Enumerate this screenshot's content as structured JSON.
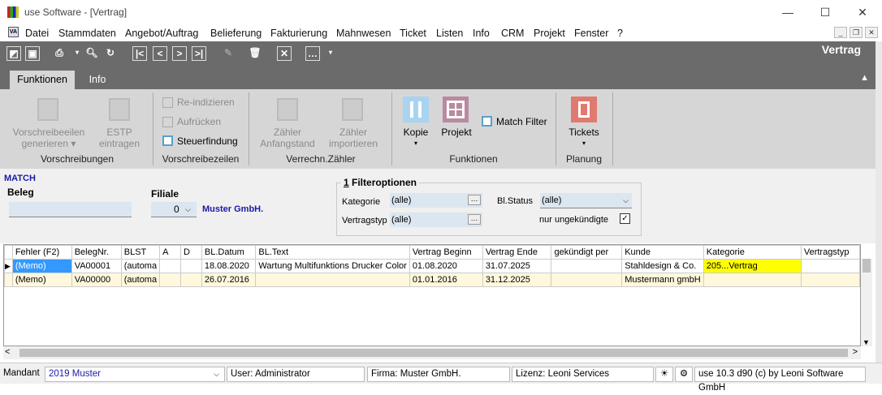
{
  "window": {
    "title": "use Software - [Vertrag]",
    "minimize": "—",
    "maximize": "☐",
    "close": "✕"
  },
  "menu": {
    "items": [
      "Datei",
      "Stammdaten",
      "Angebot/Auftrag",
      "Belieferung",
      "Fakturierung",
      "Mahnwesen",
      "Ticket",
      "Listen",
      "Info",
      "CRM",
      "Projekt",
      "Fenster",
      "?"
    ],
    "va_icon": "VA"
  },
  "toolbar": {
    "title": "Vertrag",
    "icons": [
      "new-icon",
      "save-icon",
      "print-icon",
      "search-icon",
      "refresh-icon",
      "first-icon",
      "prev-icon",
      "next-icon",
      "last-icon",
      "edit-icon",
      "delete-icon",
      "cancel-icon",
      "more-icon"
    ]
  },
  "tabs": {
    "funktionen": "Funktionen",
    "info": "Info"
  },
  "ribbon": {
    "vorschreibungen": {
      "generieren": "Vorschreibeeilen",
      "generieren2": "generieren",
      "estp": "ESTP",
      "estp2": "eintragen",
      "group": "Vorschreibungen"
    },
    "vorschreibezeilen": {
      "reindizieren": "Re-indizieren",
      "aufruecken": "Aufrücken",
      "steuerfindung": "Steuerfindung",
      "group": "Vorschreibezeilen"
    },
    "zaehler": {
      "anfangstand": "Zähler",
      "anfangstand2": "Anfangstand",
      "importieren": "Zähler",
      "importieren2": "importieren",
      "group": "Verrechn.Zähler"
    },
    "funktionen": {
      "kopie": "Kopie",
      "projekt": "Projekt",
      "match_filter": "Match Filter",
      "group": "Funktionen"
    },
    "planung": {
      "tickets": "Tickets",
      "group": "Planung"
    }
  },
  "match": {
    "label": "MATCH",
    "beleg_label": "Beleg",
    "beleg_value": "",
    "filiale_label": "Filiale",
    "filiale_value": "0",
    "filiale_name": "Muster GmbH.",
    "filter_title_num": "1",
    "filter_title": " Filteroptionen",
    "kategorie_label": "Kategorie",
    "kategorie_value": "(alle)",
    "vertragstyp_label": "Vertragstyp",
    "vertragstyp_value": "(alle)",
    "blstatus_label": "Bl.Status",
    "blstatus_value": "(alle)",
    "ungekuendigte_label": "nur ungekündigte",
    "ungekuendigte_checked": true
  },
  "grid": {
    "headers": [
      "Fehler (F2)",
      "BelegNr.",
      "BLST",
      "A",
      "D",
      "BL.Datum",
      "BL.Text",
      "Vertrag Beginn",
      "Vertrag Ende",
      "gekündigt per",
      "Kunde",
      "Kategorie",
      "Vertragstyp"
    ],
    "rows": [
      [
        "(Memo)",
        "VA00001",
        "(automa",
        "",
        "",
        "18.08.2020",
        "Wartung Multifunktions Drucker Color",
        "01.08.2020",
        "31.07.2025",
        "",
        "Stahldesign & Co.",
        "205...Vertrag",
        ""
      ],
      [
        "(Memo)",
        "VA00000",
        "(automa",
        "",
        "",
        "26.07.2016",
        "",
        "01.01.2016",
        "31.12.2025",
        "",
        "Mustermann gmbH",
        "",
        ""
      ]
    ]
  },
  "status": {
    "mandant_label": "Mandant",
    "mandant_value": "2019 Muster",
    "user": "User: Administrator",
    "firma": "Firma: Muster GmbH.",
    "lizenz": "Lizenz: Leoni Services",
    "version": "use 10.3 d90 (c) by Leoni Software GmbH"
  },
  "colors": {
    "toolbar_bg": "#6b6b6b",
    "ribbon_bg": "#d6d6d6",
    "selected_cell": "#ffff00",
    "row2_bg": "#fff8dc",
    "link_blue": "#1a1aa6"
  }
}
